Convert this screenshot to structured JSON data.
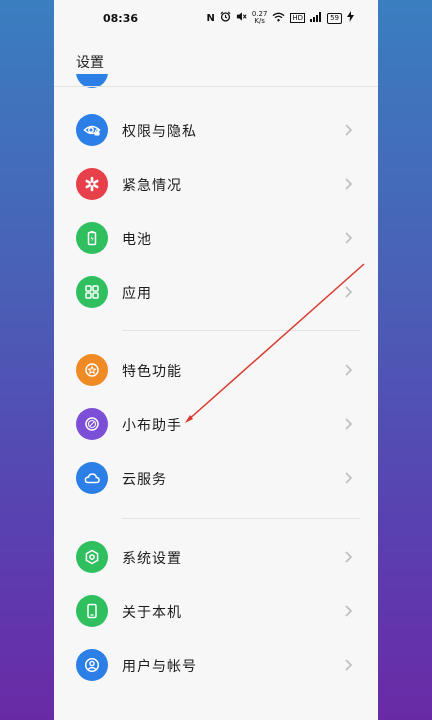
{
  "status_bar": {
    "time": "08:36",
    "nfc": "N",
    "net_speed_value": "0.27",
    "net_speed_unit": "K/s",
    "hd": "HD",
    "battery": "59"
  },
  "header": {
    "title": "设置"
  },
  "sections": [
    {
      "items": [
        {
          "label": "权限与隐私",
          "icon": "eye-lock-icon",
          "color": "#2c7fe6"
        },
        {
          "label": "紧急情况",
          "icon": "asterisk-icon",
          "color": "#e8404a"
        },
        {
          "label": "电池",
          "icon": "battery-icon",
          "color": "#2fbf5f"
        },
        {
          "label": "应用",
          "icon": "grid-icon",
          "color": "#2fbf5f"
        }
      ]
    },
    {
      "items": [
        {
          "label": "特色功能",
          "icon": "star-icon",
          "color": "#f08a24"
        },
        {
          "label": "小布助手",
          "icon": "assistant-icon",
          "color": "#7b4fd6"
        },
        {
          "label": "云服务",
          "icon": "cloud-icon",
          "color": "#2c7fe6"
        }
      ]
    },
    {
      "items": [
        {
          "label": "系统设置",
          "icon": "hexagon-gear-icon",
          "color": "#2fbf5f"
        },
        {
          "label": "关于本机",
          "icon": "phone-icon",
          "color": "#2fbf5f"
        },
        {
          "label": "用户与帐号",
          "icon": "user-icon",
          "color": "#2c7fe6"
        }
      ]
    }
  ],
  "annotation": {
    "color": "#d83a2e"
  }
}
